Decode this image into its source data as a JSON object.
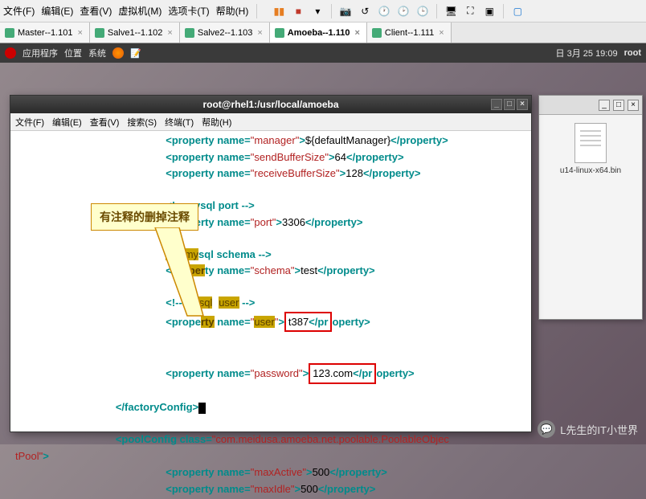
{
  "top_menu": {
    "file": "文件(F)",
    "edit": "编辑(E)",
    "view": "查看(V)",
    "vm": "虚拟机(M)",
    "tabs": "选项卡(T)",
    "help": "帮助(H)"
  },
  "tabs": [
    {
      "label": "Master--1.101",
      "active": false
    },
    {
      "label": "Salve1--1.102",
      "active": false
    },
    {
      "label": "Salve2--1.103",
      "active": false
    },
    {
      "label": "Amoeba--1.110",
      "active": true
    },
    {
      "label": "Client--1.111",
      "active": false
    }
  ],
  "gnome": {
    "apps": "应用程序",
    "places": "位置",
    "system": "系统",
    "date": "日 3月 25 19:09",
    "user": "root"
  },
  "back_window": {
    "file_name": "u14-linux-x64.bin"
  },
  "terminal": {
    "title": "root@rhel1:/usr/local/amoeba",
    "menu": {
      "file": "文件(F)",
      "edit": "编辑(E)",
      "view": "查看(V)",
      "search": "搜索(S)",
      "terminal": "终端(T)",
      "help": "帮助(H)"
    },
    "code": {
      "line1_val": "${defaultManager}",
      "prop_manager": "manager",
      "prop_sendbuf": "sendBufferSize",
      "sendbuf_val": "64",
      "prop_recvbuf": "receiveBufferSize",
      "recvbuf_val": "128",
      "comment_port": "<!-- mysql port -->",
      "prop_port": "port",
      "port_val": "3306",
      "comment_schema_hl": "<!-- my",
      "comment_schema_rest": "sql schema -->",
      "prop_schema": "schema",
      "schema_val": "test",
      "comment_user_pre": "<!-- ",
      "comment_user_hl1": "mysql",
      "comment_user_hl2": "user",
      "comment_user_post": " -->",
      "prop_user": "user",
      "user_val": "t387",
      "prop_password": "password",
      "password_val": "123.com",
      "close_factory": "factoryConfig",
      "pool_open": "poolConfig",
      "pool_class": "com.meidusa.amoeba.net.poolable.PoolableObjec",
      "tpool": "tPool",
      "prop_maxactive": "maxActive",
      "maxactive_val": "500",
      "prop_maxidle": "maxIdle",
      "maxidle_val": "500",
      "tag_property": "property",
      "attr_name": "name",
      "attr_class": "class"
    }
  },
  "callout": {
    "text": "有注释的删掉注释"
  },
  "watermark": {
    "text": "L先生的IT小世界"
  }
}
